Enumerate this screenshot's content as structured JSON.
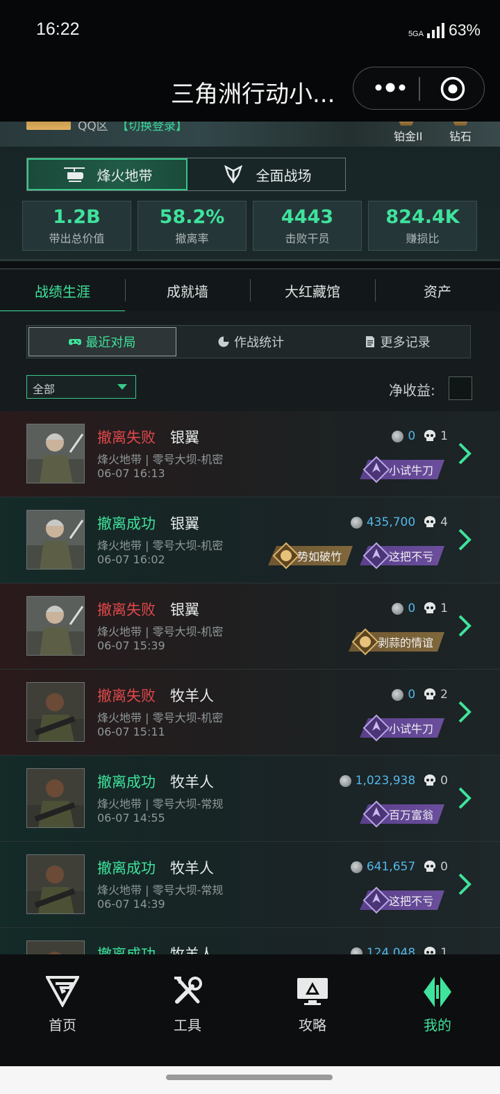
{
  "status_bar": {
    "time": "16:22",
    "network": "5GA",
    "battery": "63%"
  },
  "titlebar": {
    "title": "三角洲行动小..."
  },
  "profile": {
    "account": "QQ区",
    "switch_login": "【切换登录】",
    "ranks": [
      "铂金II",
      "钻石"
    ]
  },
  "modes": [
    {
      "label": "烽火地带",
      "active": true
    },
    {
      "label": "全面战场",
      "active": false
    }
  ],
  "stats": [
    {
      "value": "1.2B",
      "label": "带出总价值"
    },
    {
      "value": "58.2%",
      "label": "撤离率"
    },
    {
      "value": "4443",
      "label": "击败干员"
    },
    {
      "value": "824.4K",
      "label": "赚损比"
    }
  ],
  "tabs": [
    {
      "label": "战绩生涯",
      "active": true
    },
    {
      "label": "成就墙",
      "active": false
    },
    {
      "label": "大红藏馆",
      "active": false
    },
    {
      "label": "资产",
      "active": false
    }
  ],
  "subtabs": [
    {
      "label": "最近对局",
      "icon": "gamepad-icon",
      "active": true
    },
    {
      "label": "作战统计",
      "icon": "pie-chart-icon",
      "active": false
    },
    {
      "label": "更多记录",
      "icon": "document-icon",
      "active": false
    }
  ],
  "filter": {
    "selected": "全部",
    "net_label": "净收益:"
  },
  "matches": [
    {
      "result": "撤离失败",
      "status": "fail",
      "agent": "银翼",
      "map": "烽火地带 | 零号大坝-机密",
      "date": "06-07 16:13",
      "value": "0",
      "kills": "1",
      "badges": [
        {
          "label": "小试牛刀",
          "type": "purple"
        }
      ]
    },
    {
      "result": "撤离成功",
      "status": "ok",
      "agent": "银翼",
      "map": "烽火地带 | 零号大坝-机密",
      "date": "06-07 16:02",
      "value": "435,700",
      "kills": "4",
      "badges": [
        {
          "label": "势如破竹",
          "type": "gold"
        },
        {
          "label": "这把不亏",
          "type": "purple"
        }
      ]
    },
    {
      "result": "撤离失败",
      "status": "fail",
      "agent": "银翼",
      "map": "烽火地带 | 零号大坝-机密",
      "date": "06-07 15:39",
      "value": "0",
      "kills": "1",
      "badges": [
        {
          "label": "剥蒜的情谊",
          "type": "gold"
        }
      ]
    },
    {
      "result": "撤离失败",
      "status": "fail",
      "agent": "牧羊人",
      "map": "烽火地带 | 零号大坝-机密",
      "date": "06-07 15:11",
      "value": "0",
      "kills": "2",
      "badges": [
        {
          "label": "小试牛刀",
          "type": "purple"
        }
      ]
    },
    {
      "result": "撤离成功",
      "status": "ok",
      "agent": "牧羊人",
      "map": "烽火地带 | 零号大坝-常规",
      "date": "06-07 14:55",
      "value": "1,023,938",
      "kills": "0",
      "badges": [
        {
          "label": "百万富翁",
          "type": "purple"
        }
      ]
    },
    {
      "result": "撤离成功",
      "status": "ok",
      "agent": "牧羊人",
      "map": "烽火地带 | 零号大坝-常规",
      "date": "06-07 14:39",
      "value": "641,657",
      "kills": "0",
      "badges": [
        {
          "label": "这把不亏",
          "type": "purple"
        }
      ]
    },
    {
      "result": "撤离成功",
      "status": "ok",
      "agent": "牧羊人",
      "map": "",
      "date": "",
      "value": "124,048",
      "kills": "1",
      "badges": []
    }
  ],
  "bottom_nav": [
    {
      "label": "首页",
      "icon": "home-logo-icon",
      "active": false
    },
    {
      "label": "工具",
      "icon": "tools-icon",
      "active": false
    },
    {
      "label": "攻略",
      "icon": "guide-icon",
      "active": false
    },
    {
      "label": "我的",
      "icon": "profile-logo-icon",
      "active": true
    }
  ],
  "colors": {
    "accent": "#3fe39c",
    "fail": "#e0484b",
    "value": "#53b8e8",
    "badge_purple": "#5a3f8c",
    "badge_gold": "#6f5630"
  }
}
